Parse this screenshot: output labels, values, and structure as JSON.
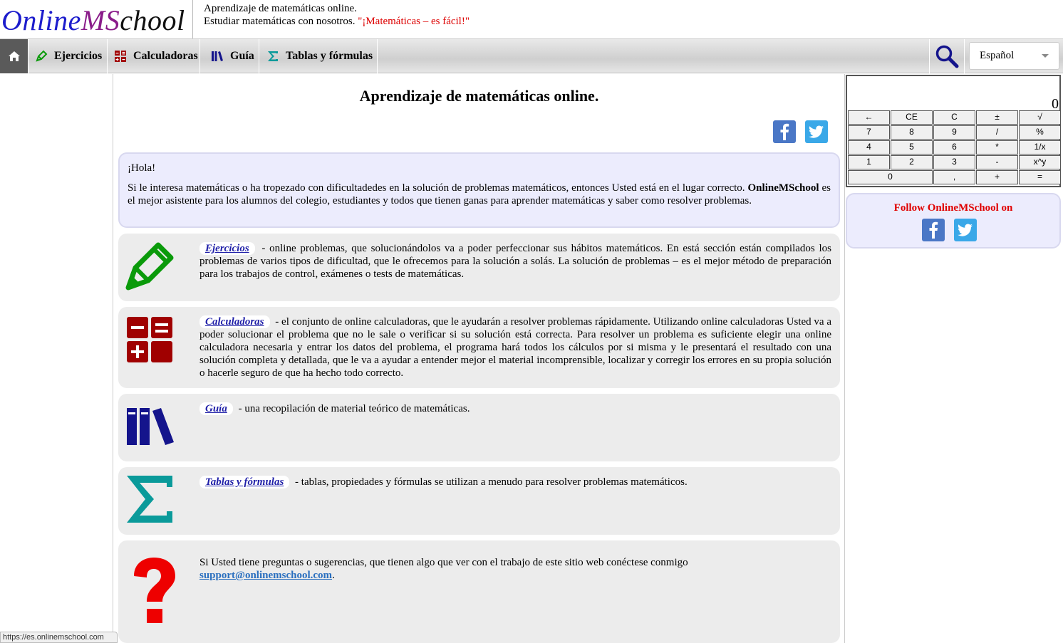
{
  "header": {
    "logo": {
      "p1": "Online",
      "p2": "",
      "p3": "MS",
      "p4": "chool"
    },
    "tagline_line1": "Aprendizaje de matemáticas online.",
    "tagline_line2": "Estudiar matemáticas con nosotros.",
    "slogan": "\"¡Matemáticas – es fácil!\""
  },
  "nav": {
    "home_icon": "home-icon",
    "items": [
      {
        "label": "Ejercicios",
        "icon": "pencil-icon"
      },
      {
        "label": "Calculadoras",
        "icon": "calculator-icon"
      },
      {
        "label": "Guía",
        "icon": "books-icon"
      },
      {
        "label": "Tablas y fórmulas",
        "icon": "sigma-icon"
      }
    ],
    "search_icon": "search-icon",
    "language": "Español"
  },
  "main": {
    "title": "Aprendizaje de matemáticas online.",
    "intro": {
      "greeting": "¡Hola!",
      "text1": "Si le interesa matemáticas o ha tropezado con dificultadedes en la solución de problemas matemáticos, entonces Usted está en el lugar correcto.",
      "brand": "OnlineMSchool",
      "text2": " es el mejor asistente para los alumnos del colegio, estudiantes y todos que tienen ganas para aprender matemáticas y saber como resolver problemas."
    },
    "cards": [
      {
        "link": "Ejercicios",
        "text": "- online problemas, que solucionándolos va a poder perfeccionar sus hábitos matemáticos. En está sección están compilados los problemas de varios tipos de dificultad, que le ofrecemos para la solución a solás. La solución de problemas – es el mejor método de preparación para los trabajos de control, exámenes o tests de matemáticas."
      },
      {
        "link": "Calculadoras",
        "text": "- el conjunto de online calculadoras, que le ayudarán a resolver problemas rápidamente. Utilizando online calculadoras Usted va a poder solucionar el problema que no le sale o verificar si su solución está correcta. Para resolver un problema es suficiente elegir una online calculadora necesaria y entrar los datos del problema, el programa hará todos los cálculos por si misma y le presentará el resultado con una solución completa y detallada, que le va a ayudar a entender mejor el material incomprensible, localizar y corregir los errores en su propia solución o hacerle seguro de que ha hecho todo correcto."
      },
      {
        "link": "Guía",
        "text": "- una recopilación de material teórico de matemáticas."
      },
      {
        "link": "Tablas y fórmulas",
        "text": "- tablas, propiedades y fórmulas se utilizan a menudo para resolver problemas matemáticos."
      }
    ],
    "contact": {
      "text": "Si Usted tiene preguntas o sugerencias, que tienen algo que ver con el trabajo de este sitio web conéctese conmigo",
      "email": "support@onlinemschool.com",
      "suffix": "."
    }
  },
  "calculator": {
    "display": "0",
    "keys": [
      "←",
      "CE",
      "C",
      "±",
      "√",
      "7",
      "8",
      "9",
      "/",
      "%",
      "4",
      "5",
      "6",
      "*",
      "1/x",
      "1",
      "2",
      "3",
      "-",
      "x^y",
      "0",
      ",",
      "+",
      "="
    ]
  },
  "follow": {
    "title": "Follow OnlineMSchool on"
  },
  "statusbar": "https://es.onlinemschool.com",
  "colors": {
    "brand_blue": "#1c1ccc",
    "slogan_red": "#dd0000",
    "calc_red": "#a00000",
    "guide_blue": "#14148c",
    "sigma_teal": "#0a9a9a",
    "pencil_green": "#0a9a0a"
  }
}
